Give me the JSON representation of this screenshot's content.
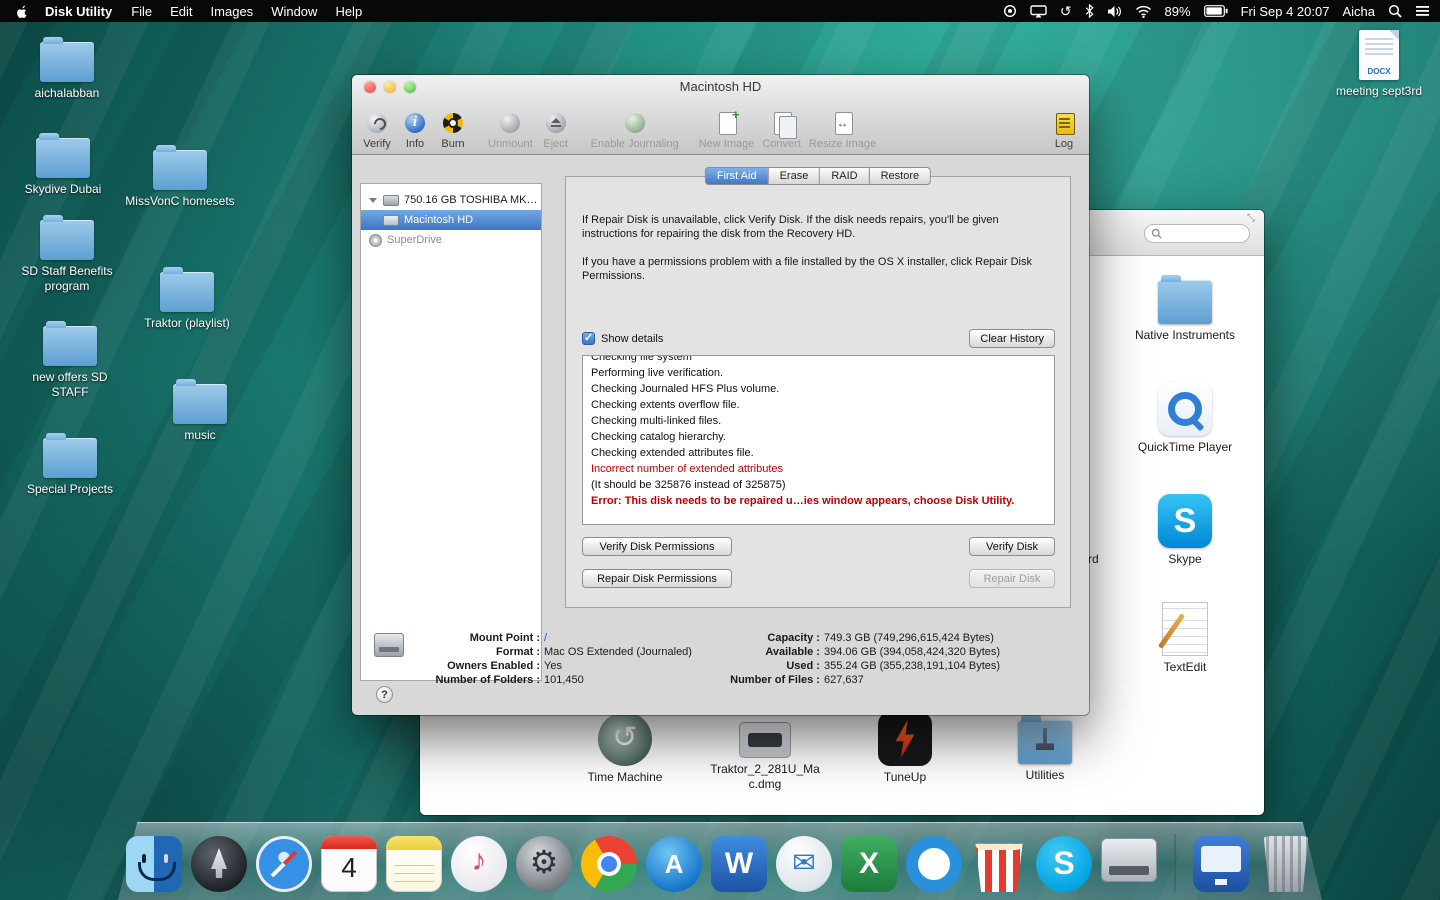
{
  "colors": {
    "selection_blue": "#3b76c6",
    "error_red": "#c00000",
    "link_blue": "#1a56c4"
  },
  "menu_bar": {
    "app_name": "Disk Utility",
    "menus": [
      {
        "label": "File"
      },
      {
        "label": "Edit"
      },
      {
        "label": "Images"
      },
      {
        "label": "Window"
      },
      {
        "label": "Help"
      }
    ],
    "battery": "89%",
    "clock": "Fri Sep 4 20:07",
    "user": "Aicha"
  },
  "desktop": {
    "icons": [
      {
        "label": "aichalabban"
      },
      {
        "label": "Skydive Dubai"
      },
      {
        "label": "MissVonC homesets"
      },
      {
        "label": "SD Staff Benefits program"
      },
      {
        "label": "Traktor (playlist)"
      },
      {
        "label": "new offers SD STAFF"
      },
      {
        "label": "music"
      },
      {
        "label": "Special Projects"
      }
    ],
    "document": {
      "label": "meeting sept3rd",
      "badge": "DOCX"
    }
  },
  "disk_utility": {
    "window_title": "Macintosh HD",
    "toolbar": [
      {
        "label": "Verify"
      },
      {
        "label": "Info"
      },
      {
        "label": "Burn"
      },
      {
        "label": "Unmount"
      },
      {
        "label": "Eject"
      },
      {
        "label": "Enable Journaling"
      },
      {
        "label": "New Image"
      },
      {
        "label": "Convert"
      },
      {
        "label": "Resize Image"
      },
      {
        "label": "Log"
      }
    ],
    "sidebar": [
      {
        "label": "750.16 GB TOSHIBA MK…"
      },
      {
        "label": "Macintosh HD"
      },
      {
        "label": "SuperDrive"
      }
    ],
    "tabs": [
      {
        "label": "First Aid"
      },
      {
        "label": "Erase"
      },
      {
        "label": "RAID"
      },
      {
        "label": "Restore"
      }
    ],
    "first_aid": {
      "paragraph_1": "If Repair Disk is unavailable, click Verify Disk. If the disk needs repairs, you'll be given instructions for repairing the disk from the Recovery HD.",
      "paragraph_2": "If you have a permissions problem with a file installed by the OS X installer, click Repair Disk Permissions.",
      "show_details": "Show details",
      "clear_history": "Clear History",
      "log_lines": [
        {
          "text": "Checking file system"
        },
        {
          "text": "Performing live verification."
        },
        {
          "text": "Checking Journaled HFS Plus volume."
        },
        {
          "text": "Checking extents overflow file."
        },
        {
          "text": "Checking multi-linked files."
        },
        {
          "text": "Checking catalog hierarchy."
        },
        {
          "text": "Checking extended attributes file."
        },
        {
          "text": "Incorrect number of extended attributes"
        },
        {
          "text": "(It should be 325876 instead of 325875)"
        },
        {
          "text": "Error: This disk needs to be repaired u…ies window appears, choose Disk Utility."
        }
      ],
      "buttons": {
        "verify_permissions": "Verify Disk Permissions",
        "repair_permissions": "Repair Disk Permissions",
        "verify_disk": "Verify Disk",
        "repair_disk": "Repair Disk"
      }
    },
    "info": {
      "left": [
        {
          "label": "Mount Point :",
          "value": "/"
        },
        {
          "label": "Format :",
          "value": "Mac OS Extended (Journaled)"
        },
        {
          "label": "Owners Enabled :",
          "value": "Yes"
        },
        {
          "label": "Number of Folders :",
          "value": "101,450"
        }
      ],
      "right": [
        {
          "label": "Capacity :",
          "value": "749.3 GB (749,296,615,424 Bytes)"
        },
        {
          "label": "Available :",
          "value": "394.06 GB (394,058,424,320 Bytes)"
        },
        {
          "label": "Used :",
          "value": "355.24 GB (355,238,191,104 Bytes)"
        },
        {
          "label": "Number of Files :",
          "value": "627,637"
        }
      ]
    }
  },
  "finder": {
    "items": [
      {
        "label": "Native Instruments"
      },
      {
        "label": "QuickTime Player"
      },
      {
        "label": "Skype"
      },
      {
        "label": "TextEdit"
      },
      {
        "label": "Time Machine"
      },
      {
        "label": "Traktor_2_281U_Mac.dmg"
      },
      {
        "label": "TuneUp"
      },
      {
        "label": "Utilities"
      }
    ],
    "partial_label": "rd"
  },
  "glyphs": {
    "word": "W",
    "excel": "X",
    "skype": "S",
    "appstore": "A"
  },
  "dock": {
    "calendar_day": "4",
    "items": [
      "finder",
      "launchpad",
      "safari",
      "calendar",
      "notes",
      "itunes",
      "system-preferences",
      "chrome",
      "app-store",
      "word",
      "mail",
      "excel",
      "blue-ring-app",
      "popcorn-time",
      "skype",
      "external-drive",
      "display-app",
      "trash"
    ]
  }
}
